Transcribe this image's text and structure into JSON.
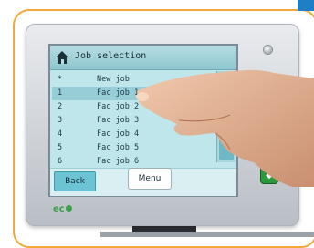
{
  "screen": {
    "title": "Job selection",
    "title_icon": "home-icon",
    "jobs": [
      {
        "index": "*",
        "name": "New job"
      },
      {
        "index": "1",
        "name": "Fac job 1",
        "selected": true
      },
      {
        "index": "2",
        "name": "Fac job 2"
      },
      {
        "index": "3",
        "name": "Fac job 3"
      },
      {
        "index": "4",
        "name": "Fac job 4"
      },
      {
        "index": "5",
        "name": "Fac job 5"
      },
      {
        "index": "6",
        "name": "Fac job 6"
      }
    ],
    "back_label": "Back",
    "menu_label": "Menu"
  },
  "device": {
    "logo_text": "ec",
    "stop_button_icon": "stop-icon",
    "start_button_icon": "start-diamond-icon",
    "colors": {
      "frame": "#f3a73a",
      "screen": "#bfe6ea",
      "stop": "#d33232",
      "start": "#2a9a3c"
    }
  }
}
